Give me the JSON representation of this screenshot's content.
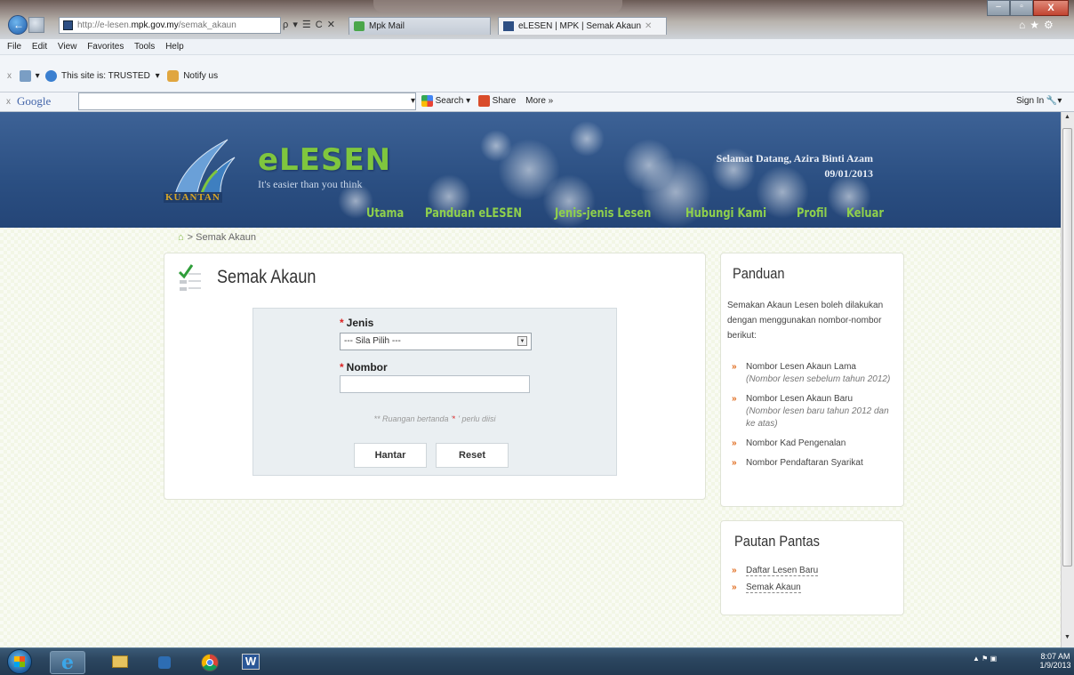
{
  "browser": {
    "url_host_pre": "http://e-lesen.",
    "url_host_bold": "mpk.gov.my",
    "url_path": "/semak_akaun",
    "addr_controls": "ρ ▾ ☰ C ✕",
    "tabs": [
      {
        "label": "Mpk Mail"
      },
      {
        "label": "eLESEN | MPK | Semak Akaun",
        "close": "✕"
      }
    ],
    "menu": [
      "File",
      "Edit",
      "View",
      "Favorites",
      "Tools",
      "Help"
    ],
    "toolbar": {
      "close": "x",
      "site_status": "This site is: TRUSTED",
      "notify": "Notify us"
    },
    "google_bar": {
      "close": "x",
      "logo": "Google",
      "search": "Search",
      "share": "Share",
      "more": "More »",
      "sign_in": "Sign In"
    },
    "window_buttons": {
      "min": "–",
      "max": "▫",
      "close": "X"
    }
  },
  "site": {
    "brand": "eLESEN",
    "tagline": "It's easier than you think",
    "kuantan": "KUANTAN",
    "welcome": "Selamat Datang, Azira Binti Azam",
    "date": "09/01/2013",
    "nav": [
      "Utama",
      "Panduan eLESEN",
      "Jenis-jenis Lesen",
      "Hubungi Kami",
      "Profil",
      "Keluar"
    ],
    "breadcrumb": "Semak Akaun"
  },
  "form": {
    "title": "Semak Akaun",
    "jenis_label": "Jenis",
    "jenis_value": "--- Sila Pilih ---",
    "nombor_label": "Nombor",
    "nombor_value": "",
    "note_pre": "** Ruangan bertanda '",
    "note_star": "*",
    "note_post": "' perlu diisi",
    "hantar": "Hantar",
    "reset": "Reset",
    "required_mark": "*"
  },
  "panduan": {
    "title": "Panduan",
    "desc": "Semakan Akaun Lesen boleh dilakukan dengan menggunakan nombor-nombor berikut:",
    "items": [
      {
        "label": "Nombor Lesen Akaun Lama",
        "sub": "(Nombor lesen sebelum tahun 2012)"
      },
      {
        "label": "Nombor Lesen Akaun Baru",
        "sub": "(Nombor lesen baru tahun 2012 dan ke atas)"
      },
      {
        "label": "Nombor Kad Pengenalan",
        "sub": ""
      },
      {
        "label": "Nombor Pendaftaran Syarikat",
        "sub": ""
      }
    ]
  },
  "pautan": {
    "title": "Pautan Pantas",
    "links": [
      "Daftar Lesen Baru",
      "Semak Akaun"
    ]
  },
  "taskbar": {
    "time": "8:07 AM",
    "date": "1/9/2013",
    "word_letter": "W",
    "ie_letter": "e"
  },
  "colors": {
    "header_blue": "#2b4f82",
    "nav_green": "#8fd04c",
    "bullet_orange": "#e06a1c",
    "required_red": "#dd2222"
  }
}
